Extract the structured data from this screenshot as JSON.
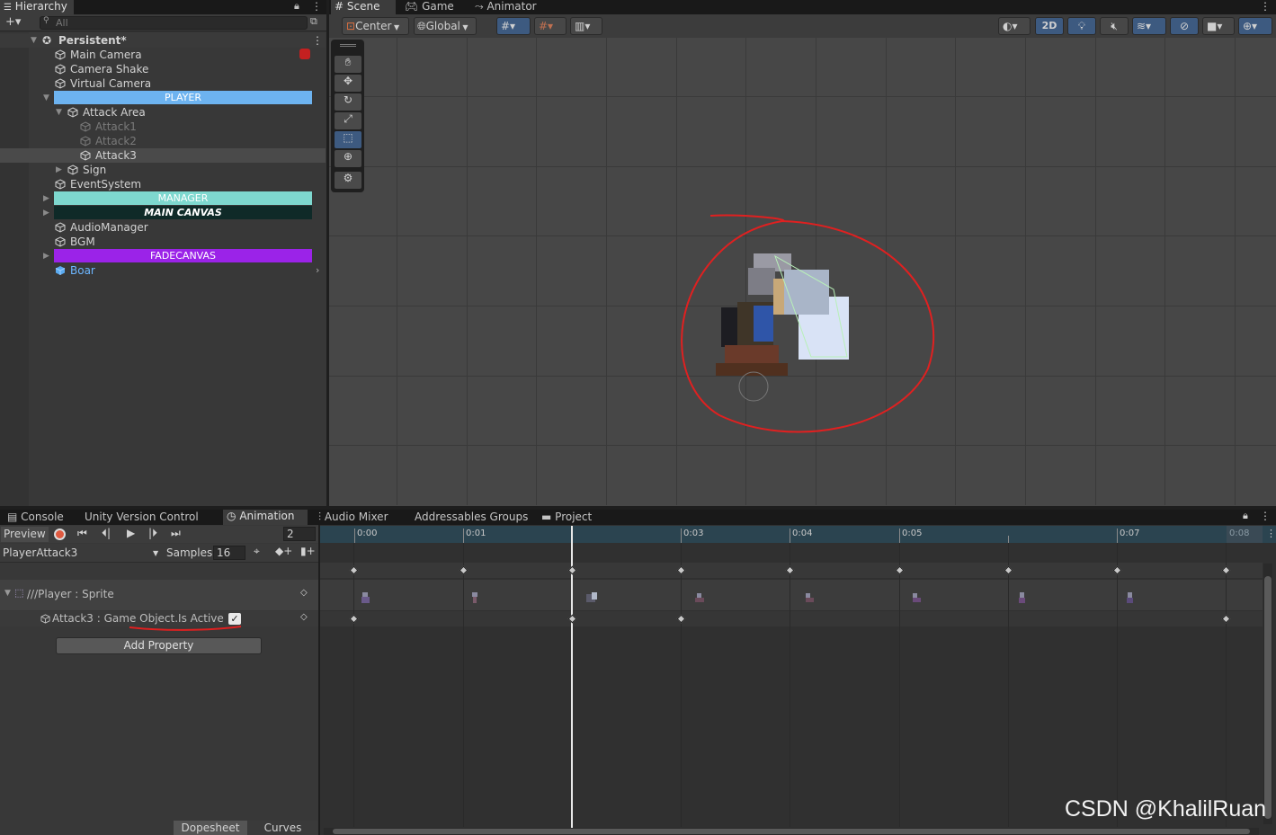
{
  "hierarchy": {
    "tab_label": "Hierarchy",
    "add_label": "+▾",
    "search_placeholder": "All",
    "scene_name": "Persistent*",
    "items": [
      {
        "label": "Main Camera"
      },
      {
        "label": "Camera Shake"
      },
      {
        "label": "Virtual Camera"
      },
      {
        "label": "PLAYER"
      },
      {
        "label": "Attack Area"
      },
      {
        "label": "Attack1"
      },
      {
        "label": "Attack2"
      },
      {
        "label": "Attack3"
      },
      {
        "label": "Sign"
      },
      {
        "label": "EventSystem"
      },
      {
        "label": "MANAGER"
      },
      {
        "label": "MAIN CANVAS"
      },
      {
        "label": "AudioManager"
      },
      {
        "label": "BGM"
      },
      {
        "label": "FADECANVAS"
      },
      {
        "label": "Boar"
      }
    ]
  },
  "scene": {
    "tabs": [
      {
        "label": "Scene"
      },
      {
        "label": "Game"
      },
      {
        "label": "Animator"
      }
    ],
    "pivot_label": "Center",
    "space_label": "Global",
    "mode_2d_label": "2D"
  },
  "bottom": {
    "tabs": [
      {
        "label": "Console"
      },
      {
        "label": "Unity Version Control"
      },
      {
        "label": "Animation"
      },
      {
        "label": "Audio Mixer"
      },
      {
        "label": "Addressables Groups"
      },
      {
        "label": "Project"
      }
    ]
  },
  "animation": {
    "preview_label": "Preview",
    "frame_value": "2",
    "clip_name": "PlayerAttack3",
    "samples_label": "Samples",
    "samples_value": "16",
    "property_sprite": "///Player : Sprite",
    "property_active": "Attack3 : Game Object.Is Active",
    "active_checked": true,
    "add_property_label": "Add Property",
    "dopesheet_label": "Dopesheet",
    "curves_label": "Curves",
    "ruler": [
      {
        "label": "0:00"
      },
      {
        "label": "0:01"
      },
      {
        "label": "0:03"
      },
      {
        "label": "0:04"
      },
      {
        "label": "0:05"
      },
      {
        "label": "0:07"
      },
      {
        "label": "0:08"
      }
    ]
  },
  "watermark": "CSDN @KhalilRuan",
  "colors": {
    "player_bar": "#6db3f0",
    "manager_bar": "#7ed8cf",
    "canvas_bar": "#0f2a28",
    "fade_bar": "#9b23e8",
    "accent": "#3d5a80",
    "annotation": "#e02020"
  }
}
